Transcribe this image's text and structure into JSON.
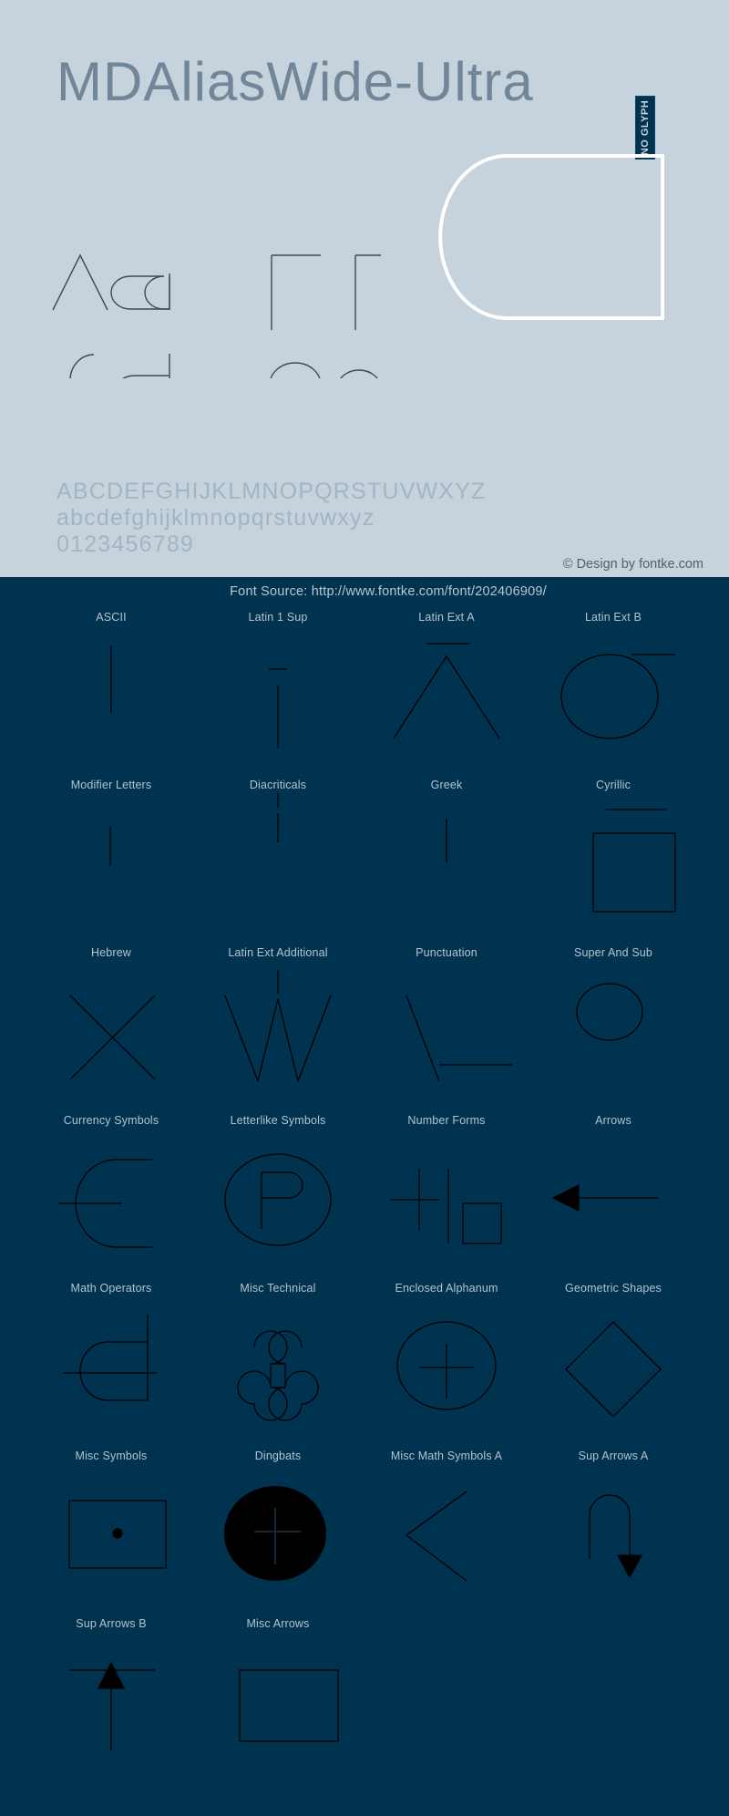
{
  "page": {
    "background_light": "#c6d2dc",
    "background_dark": "#00334f",
    "stroke_color": "#000000",
    "title_color": "#6d8296",
    "label_color": "#b4c3cf"
  },
  "header": {
    "font_title": "MDAliasWide-Ultra",
    "no_glyph_badge": "NO GLYPH"
  },
  "preview": {
    "pairs": [
      "Aa",
      "Ff",
      "Gg",
      "Oo"
    ],
    "large_glyph": "D"
  },
  "alphabet": {
    "uppercase": "ABCDEFGHIJKLMNOPQRSTUVWXYZ",
    "lowercase": "abcdefghijklmnopqrstuvwxyz",
    "digits": "0123456789"
  },
  "footer": {
    "copyright": "© Design by fontke.com",
    "font_source": "Font Source: http://www.fontke.com/font/202406909/"
  },
  "unicode_blocks": [
    [
      {
        "label": "ASCII",
        "glyph": "vbar"
      },
      {
        "label": "Latin 1 Sup",
        "glyph": "macron-bar"
      },
      {
        "label": "Latin Ext A",
        "glyph": "A-macron"
      },
      {
        "label": "Latin Ext B",
        "glyph": "O-bar"
      }
    ],
    [
      {
        "label": "Modifier Letters",
        "glyph": "tick-low"
      },
      {
        "label": "Diacriticals",
        "glyph": "tick-high"
      },
      {
        "label": "Greek",
        "glyph": "tick-mid"
      },
      {
        "label": "Cyrillic",
        "glyph": "box-open"
      }
    ],
    [
      {
        "label": "Hebrew",
        "glyph": "x-cross"
      },
      {
        "label": "Latin Ext Additional",
        "glyph": "w-zigzag"
      },
      {
        "label": "Punctuation",
        "glyph": "v-dash"
      },
      {
        "label": "Super And Sub",
        "glyph": "oval"
      }
    ],
    [
      {
        "label": "Currency Symbols",
        "glyph": "c-strike"
      },
      {
        "label": "Letterlike Symbols",
        "glyph": "p-circled"
      },
      {
        "label": "Number Forms",
        "glyph": "plus-bars"
      },
      {
        "label": "Arrows",
        "glyph": "arrow-left"
      }
    ],
    [
      {
        "label": "Math Operators",
        "glyph": "d-plus"
      },
      {
        "label": "Misc Technical",
        "glyph": "command"
      },
      {
        "label": "Enclosed Alphanum",
        "glyph": "circled-plus"
      },
      {
        "label": "Geometric Shapes",
        "glyph": "diamond"
      }
    ],
    [
      {
        "label": "Misc Symbols",
        "glyph": "box-dot"
      },
      {
        "label": "Dingbats",
        "glyph": "filled-circle-plus"
      },
      {
        "label": "Misc Math Symbols A",
        "glyph": "angle-left"
      },
      {
        "label": "Sup Arrows A",
        "glyph": "arrow-hook-down"
      }
    ],
    [
      {
        "label": "Sup Arrows B",
        "glyph": "arrow-up-bar"
      },
      {
        "label": "Misc Arrows",
        "glyph": "rect"
      }
    ]
  ]
}
